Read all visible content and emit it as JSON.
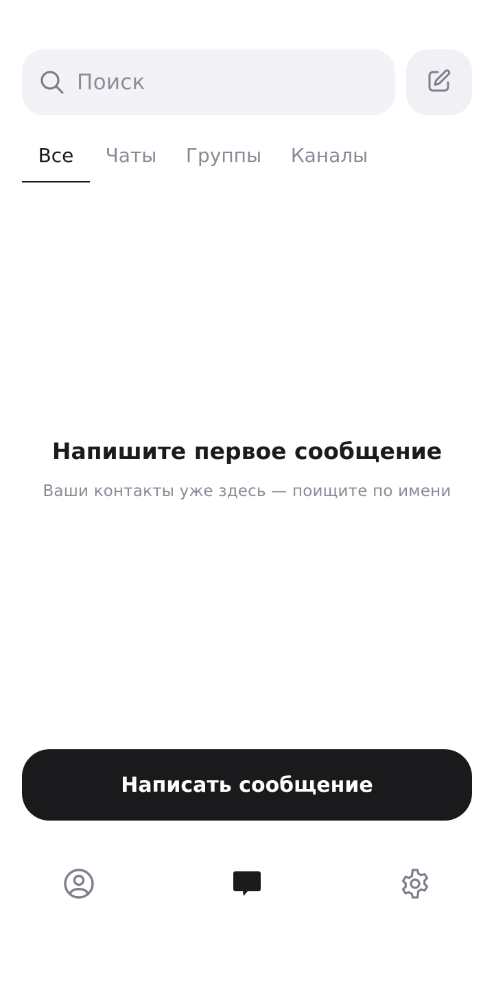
{
  "search": {
    "placeholder": "Поиск",
    "icon": "search-icon"
  },
  "header": {
    "compose_icon": "compose-icon"
  },
  "tabs": [
    {
      "label": "Все",
      "active": true
    },
    {
      "label": "Чаты",
      "active": false
    },
    {
      "label": "Группы",
      "active": false
    },
    {
      "label": "Каналы",
      "active": false
    }
  ],
  "empty_state": {
    "title": "Напишите первое сообщение",
    "subtitle": "Ваши контакты уже здесь — поищите по имени"
  },
  "cta": {
    "label": "Написать сообщение"
  },
  "bottom_nav": [
    {
      "icon": "profile-icon",
      "active": false
    },
    {
      "icon": "chat-bubble-icon",
      "active": true
    },
    {
      "icon": "gear-icon",
      "active": false
    }
  ],
  "colors": {
    "background": "#ffffff",
    "search_bg": "#f3f3f7",
    "text_primary": "#1b1b1d",
    "text_secondary": "#8a8996",
    "button_bg": "#1a1a1c",
    "button_text": "#ffffff",
    "icon_inactive": "#7f7e8c"
  }
}
